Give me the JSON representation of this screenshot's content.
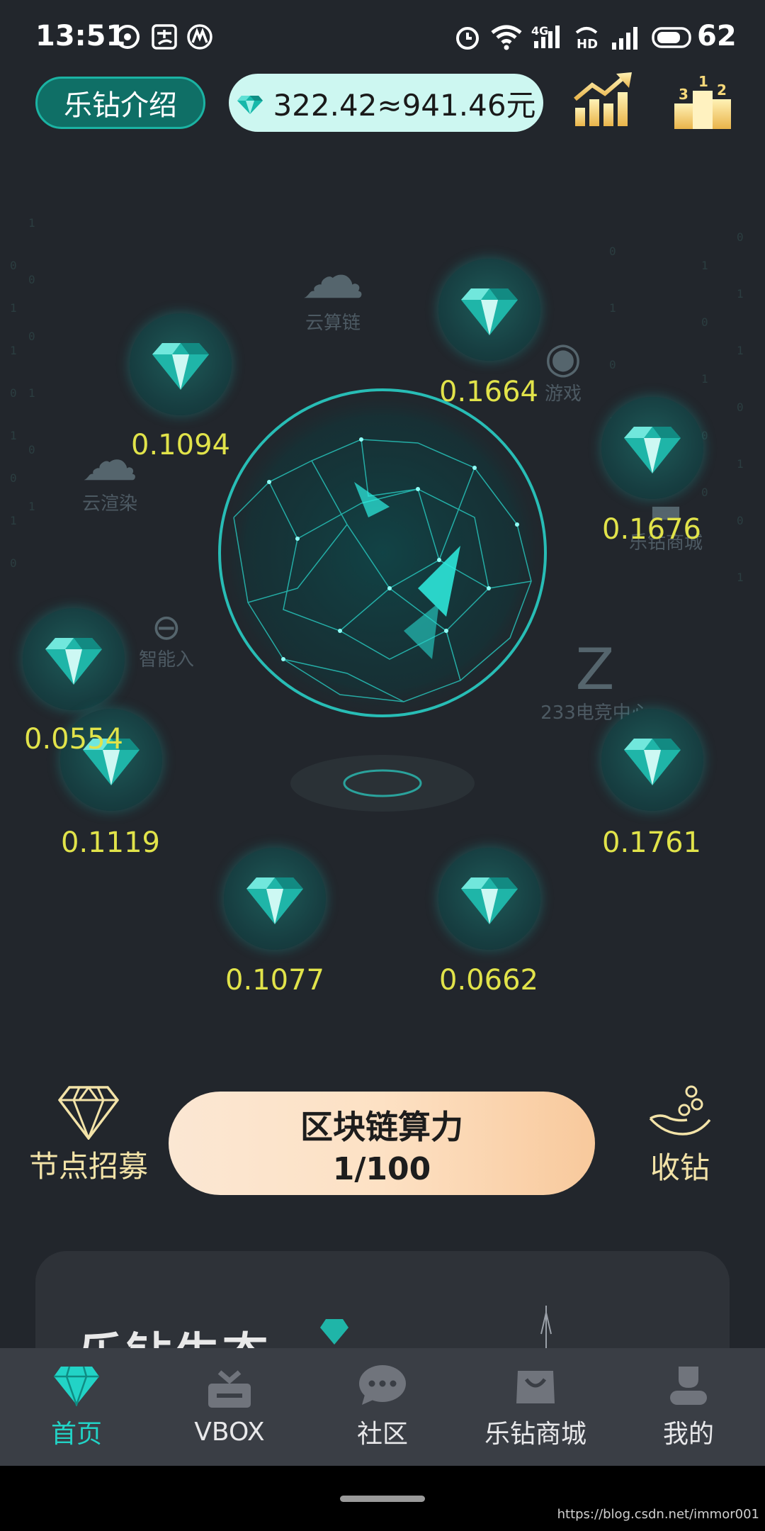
{
  "status_bar": {
    "time": "13:51",
    "battery": "62",
    "net_label": "4G"
  },
  "header": {
    "intro_label": "乐钻介绍",
    "balance": "322.42≈941.46元"
  },
  "background_labels": {
    "yunsuanlian": "云算链",
    "yunxuanran": "云渲染",
    "youxi": "游戏",
    "shangcheng": "乐钻商城",
    "dianjing": "233电竞中心",
    "zhineng": "智能入"
  },
  "gems": [
    {
      "value": "0.1094"
    },
    {
      "value": "0.1664"
    },
    {
      "value": "0.1676"
    },
    {
      "value": "0.0554"
    },
    {
      "value": "0.1119"
    },
    {
      "value": "0.1761"
    },
    {
      "value": "0.1077"
    },
    {
      "value": "0.0662"
    }
  ],
  "actions": {
    "node_recruit": "节点招募",
    "compute_title": "区块链算力",
    "compute_value": "1/100",
    "collect": "收钻"
  },
  "card": {
    "title": "乐钻生态"
  },
  "nav": {
    "items": [
      {
        "label": "首页",
        "icon": "diamond-icon",
        "active": true
      },
      {
        "label": "VBOX",
        "icon": "vbox-icon"
      },
      {
        "label": "社区",
        "icon": "chat-bubble-icon"
      },
      {
        "label": "乐钻商城",
        "icon": "shopping-bag-icon"
      },
      {
        "label": "我的",
        "icon": "person-icon"
      }
    ]
  },
  "watermark": "https://blog.csdn.net/immor001",
  "colors": {
    "accent": "#22d3c6",
    "gem_value": "#e1e34a",
    "background": "#22262c"
  }
}
